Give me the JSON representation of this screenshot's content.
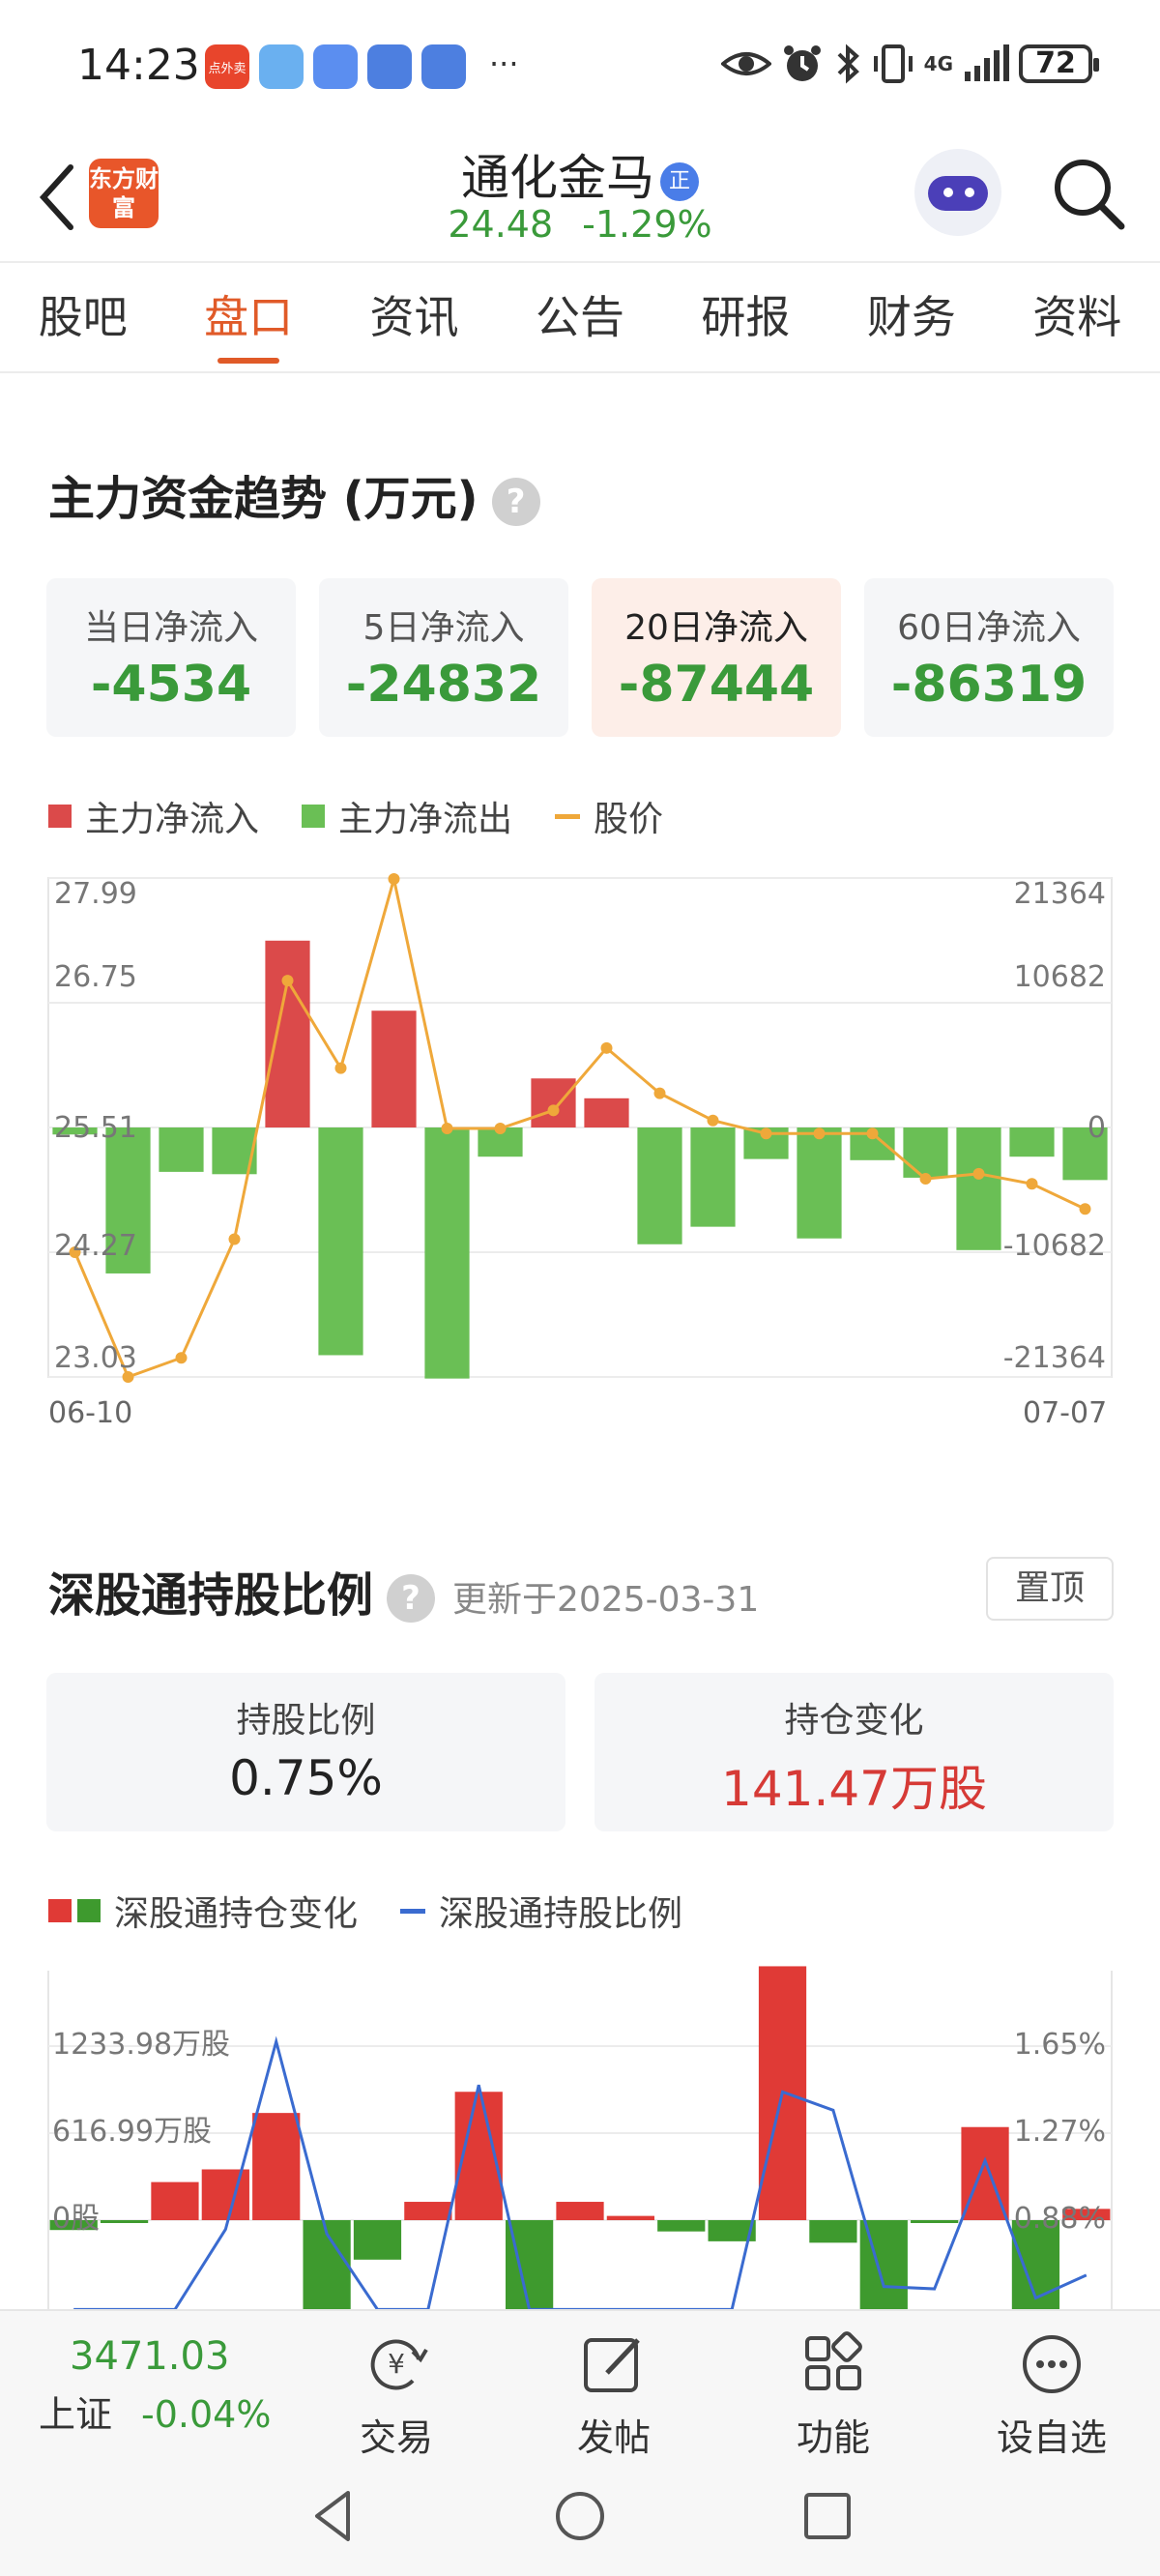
{
  "status": {
    "time": "14:23",
    "battery": "72",
    "apps": [
      {
        "icon": "takeout-app-icon",
        "label": "点外卖",
        "color": "#e8452c"
      },
      {
        "icon": "weather-app-icon",
        "label": "",
        "color": "#6ab0f0"
      },
      {
        "icon": "message-app-icon",
        "label": "",
        "color": "#5b8ef0"
      },
      {
        "icon": "security-app-icon",
        "label": "",
        "color": "#4d7fe0"
      },
      {
        "icon": "security-app-icon-2",
        "label": "",
        "color": "#4d7fe0"
      }
    ],
    "more": "···",
    "signal": "4G"
  },
  "header": {
    "logo_text": "东方财富",
    "title": "通化金马",
    "badge": "正",
    "price": "24.48",
    "change": "-1.29%"
  },
  "tabs": [
    {
      "label": "股吧",
      "active": false
    },
    {
      "label": "盘口",
      "active": true
    },
    {
      "label": "资讯",
      "active": false
    },
    {
      "label": "公告",
      "active": false
    },
    {
      "label": "研报",
      "active": false
    },
    {
      "label": "财务",
      "active": false
    },
    {
      "label": "资料",
      "active": false
    }
  ],
  "capital_flow": {
    "title": "主力资金趋势 (万元)",
    "help": "?",
    "cards": [
      {
        "label": "当日净流入",
        "value": "-4534"
      },
      {
        "label": "5日净流入",
        "value": "-24832"
      },
      {
        "label": "20日净流入",
        "value": "-87444"
      },
      {
        "label": "60日净流入",
        "value": "-86319"
      }
    ],
    "legend": {
      "inflow": "主力净流入",
      "outflow": "主力净流出",
      "price": "股价"
    },
    "colors": {
      "inflow": "#db4a4a",
      "outflow": "#6abf55",
      "price": "#efa83a"
    },
    "start_date": "06-10",
    "end_date": "07-07"
  },
  "hk_connect": {
    "title": "深股通持股比例",
    "help": "?",
    "updated": "更新于2025-03-31",
    "pin": "置顶",
    "cards": [
      {
        "label": "持股比例",
        "value": "0.75%"
      },
      {
        "label": "持仓变化",
        "value": "141.47万股"
      }
    ],
    "legend": {
      "change": "深股通持仓变化",
      "ratio": "深股通持股比例"
    },
    "colors": {
      "up": "#e03a36",
      "down": "#3e9a2e",
      "line": "#3a6bd0"
    }
  },
  "bottom_bar": {
    "index_value": "3471.03",
    "index_name": "上证",
    "index_change": "-0.04%",
    "items": [
      {
        "label": "交易",
        "icon": "trade-icon"
      },
      {
        "label": "发帖",
        "icon": "post-icon"
      },
      {
        "label": "功能",
        "icon": "apps-icon"
      },
      {
        "label": "设自选",
        "icon": "add-watchlist-icon"
      }
    ]
  },
  "chart_data": [
    {
      "type": "bar",
      "title": "主力资金趋势 (万元)",
      "x_start": "06-10",
      "x_end": "07-07",
      "left_axis_ticks": [
        "27.99",
        "26.75",
        "25.51",
        "24.27",
        "23.03"
      ],
      "right_axis_ticks": [
        "21364",
        "10682",
        "0",
        "-10682",
        "-21364"
      ],
      "ylim_flow": [
        -21364,
        21364
      ],
      "ylim_price": [
        23.03,
        27.99
      ],
      "series": [
        {
          "name": "主力净流入 / 主力净流出",
          "kind": "bar",
          "values": [
            -600,
            -12500,
            -3800,
            -4000,
            16000,
            -19500,
            10000,
            -21500,
            -2500,
            4200,
            2500,
            -10000,
            -8500,
            -2700,
            -9500,
            -2800,
            -4300,
            -10500,
            -2500,
            -4500
          ]
        },
        {
          "name": "股价",
          "kind": "line",
          "values": [
            24.27,
            23.03,
            23.22,
            24.4,
            26.97,
            26.1,
            27.98,
            25.5,
            25.5,
            25.68,
            26.3,
            25.85,
            25.58,
            25.45,
            25.45,
            25.45,
            25.0,
            25.05,
            24.95,
            24.7
          ]
        }
      ]
    },
    {
      "type": "bar",
      "title": "深股通持股比例",
      "left_axis_ticks": [
        "1233.98万股",
        "616.99万股",
        "0股"
      ],
      "right_axis_ticks": [
        "1.65%",
        "1.27%",
        "0.88%"
      ],
      "ylim_change": [
        -616.99,
        1233.98
      ],
      "ylim_ratio": [
        0.49,
        1.65
      ],
      "series": [
        {
          "name": "深股通持仓变化",
          "kind": "bar",
          "values": [
            -70,
            -10,
            270,
            360,
            760,
            -800,
            -280,
            130,
            910,
            -1150,
            130,
            30,
            -80,
            -150,
            1800,
            -160,
            -700,
            -20,
            660,
            -700,
            80
          ]
        },
        {
          "name": "深股通持股比例",
          "kind": "line",
          "values": [
            0.5,
            0.5,
            0.5,
            0.85,
            1.67,
            0.83,
            0.5,
            0.5,
            1.48,
            0.5,
            0.5,
            0.5,
            0.5,
            0.5,
            1.45,
            1.37,
            0.6,
            0.59,
            1.15,
            0.55,
            0.65
          ]
        }
      ]
    }
  ]
}
